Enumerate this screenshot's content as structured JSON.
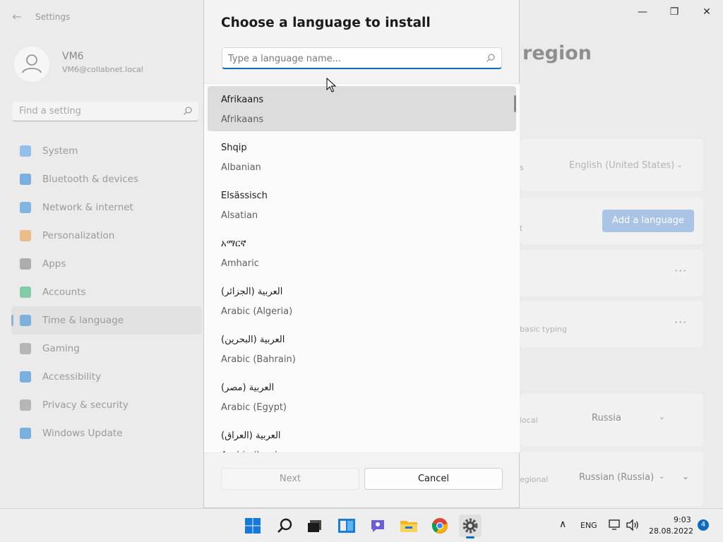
{
  "window": {
    "app_title": "Settings",
    "back_glyph": "←",
    "minimize_glyph": "—",
    "maximize_glyph": "❐",
    "close_glyph": "✕"
  },
  "profile": {
    "name": "VM6",
    "email": "VM6@collabnet.local"
  },
  "search": {
    "placeholder": "Find a setting"
  },
  "sidebar": {
    "items": [
      {
        "label": "System",
        "icon": "monitor-icon",
        "color": "#4a9be8"
      },
      {
        "label": "Bluetooth & devices",
        "icon": "bluetooth-icon",
        "color": "#1c7fd6"
      },
      {
        "label": "Network & internet",
        "icon": "wifi-icon",
        "color": "#2a86d8"
      },
      {
        "label": "Personalization",
        "icon": "brush-icon",
        "color": "#e7953b"
      },
      {
        "label": "Apps",
        "icon": "apps-icon",
        "color": "#7a7a7a"
      },
      {
        "label": "Accounts",
        "icon": "person-icon",
        "color": "#2fb36e"
      },
      {
        "label": "Time & language",
        "icon": "globe-clock-icon",
        "color": "#2a86d8",
        "active": true
      },
      {
        "label": "Gaming",
        "icon": "controller-icon",
        "color": "#8a8a8a"
      },
      {
        "label": "Accessibility",
        "icon": "accessibility-icon",
        "color": "#1c7fd6"
      },
      {
        "label": "Privacy & security",
        "icon": "shield-icon",
        "color": "#8a8a8a"
      },
      {
        "label": "Windows Update",
        "icon": "update-icon",
        "color": "#1c7fd6"
      }
    ]
  },
  "background_page": {
    "title_fragment": "region",
    "display_language_label_fragment": "s",
    "display_language_value": "English (United States)",
    "preferred_languages_label_fragment": "t",
    "add_language_label": "Add a language",
    "typing_label_fragment": "basic typing",
    "more_glyph": "···",
    "country_label_fragment": "local",
    "country_value": "Russia",
    "regional_label_fragment": "egional",
    "regional_value": "Russian (Russia)"
  },
  "dialog": {
    "title": "Choose a language to install",
    "search_placeholder": "Type a language name...",
    "next_label": "Next",
    "cancel_label": "Cancel",
    "languages": [
      {
        "native": "Afrikaans",
        "english": "Afrikaans"
      },
      {
        "native": "Shqip",
        "english": "Albanian"
      },
      {
        "native": "Elsässisch",
        "english": "Alsatian"
      },
      {
        "native": "አማርኛ",
        "english": "Amharic"
      },
      {
        "native": "العربية (الجزائر)",
        "english": "Arabic (Algeria)"
      },
      {
        "native": "العربية (البحرين)",
        "english": "Arabic (Bahrain)"
      },
      {
        "native": "العربية (مصر)",
        "english": "Arabic (Egypt)"
      },
      {
        "native": "العربية (العراق)",
        "english": "Arabic (Iraq)"
      }
    ]
  },
  "taskbar": {
    "apps": [
      "windows-start-icon",
      "search-icon",
      "task-view-icon",
      "widgets-icon",
      "chat-icon",
      "file-explorer-icon",
      "chrome-icon",
      "settings-icon"
    ],
    "language": "ENG",
    "time": "9:03",
    "date": "28.08.2022",
    "notification_count": "4",
    "chevron_glyph": "∧"
  }
}
